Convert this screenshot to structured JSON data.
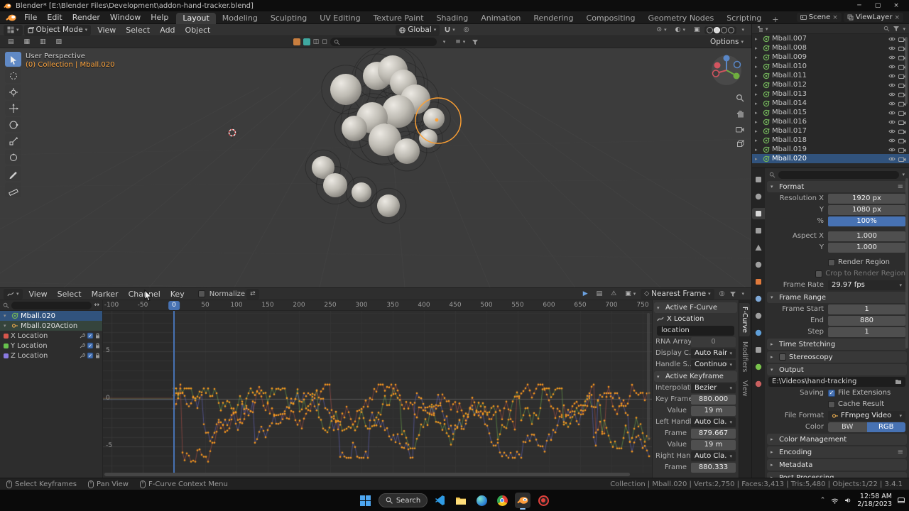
{
  "window": {
    "title": "Blender* [E:\\Blender Files\\Development\\addon-hand-tracker.blend]"
  },
  "topbar": {
    "menus": [
      "File",
      "Edit",
      "Render",
      "Window",
      "Help"
    ],
    "workspaces": [
      "Layout",
      "Modeling",
      "Sculpting",
      "UV Editing",
      "Texture Paint",
      "Shading",
      "Animation",
      "Rendering",
      "Compositing",
      "Geometry Nodes",
      "Scripting"
    ],
    "active_workspace": "Layout",
    "add_workspace": "+",
    "scene": "Scene",
    "view_layer": "ViewLayer"
  },
  "viewport": {
    "mode": "Object Mode",
    "menus": [
      "View",
      "Select",
      "Add",
      "Object"
    ],
    "orientation": "Global",
    "options_label": "Options",
    "overlay": {
      "perspective": "User Perspective",
      "collection": "(0) Collection | Mball.020"
    }
  },
  "outliner": {
    "items": [
      "Mball.007",
      "Mball.008",
      "Mball.009",
      "Mball.010",
      "Mball.011",
      "Mball.012",
      "Mball.013",
      "Mball.014",
      "Mball.015",
      "Mball.016",
      "Mball.017",
      "Mball.018",
      "Mball.019",
      "Mball.020"
    ],
    "active": "Mball.020"
  },
  "properties": {
    "sections": [
      {
        "title": "Format",
        "expanded": true,
        "preset_icon": true,
        "rows": [
          {
            "t": "field",
            "label": "Resolution X",
            "value": "1920 px"
          },
          {
            "t": "field",
            "label": "Y",
            "value": "1080 px"
          },
          {
            "t": "slider",
            "label": "%",
            "value": "100%"
          },
          {
            "t": "gap"
          },
          {
            "t": "field",
            "label": "Aspect X",
            "value": "1.000"
          },
          {
            "t": "field",
            "label": "Y",
            "value": "1.000"
          },
          {
            "t": "gap"
          },
          {
            "t": "check",
            "label": "Render Region",
            "checked": false
          },
          {
            "t": "check",
            "label": "Crop to Render Region",
            "checked": false,
            "dim": true
          },
          {
            "t": "dropdown",
            "label": "Frame Rate",
            "value": "29.97 fps"
          }
        ]
      },
      {
        "title": "Frame Range",
        "expanded": true,
        "rows": [
          {
            "t": "field",
            "label": "Frame Start",
            "value": "1"
          },
          {
            "t": "field",
            "label": "End",
            "value": "880"
          },
          {
            "t": "field",
            "label": "Step",
            "value": "1"
          }
        ]
      },
      {
        "title": "Time Stretching",
        "expanded": false
      },
      {
        "title": "Stereoscopy",
        "expanded": false,
        "checkbox": true
      },
      {
        "title": "Output",
        "expanded": true,
        "rows": [
          {
            "t": "path",
            "value": "E:\\Videos\\hand-tracking"
          },
          {
            "t": "check",
            "prefix": "Saving",
            "label": "File Extensions",
            "checked": true
          },
          {
            "t": "check",
            "label": "Cache Result",
            "checked": false
          },
          {
            "t": "dropdown",
            "label": "File Format",
            "value": "FFmpeg Video",
            "icon": true
          },
          {
            "t": "toggle2",
            "label": "Color",
            "options": [
              "BW",
              "RGB"
            ],
            "active": 1
          }
        ]
      },
      {
        "title": "Color Management",
        "expanded": false
      },
      {
        "title": "Encoding",
        "expanded": false,
        "preset_icon": true
      },
      {
        "title": "Metadata",
        "expanded": false
      },
      {
        "title": "Post Processing",
        "expanded": false
      }
    ]
  },
  "graph_editor": {
    "menus": [
      "View",
      "Select",
      "Marker",
      "Channel",
      "Key"
    ],
    "normalize_label": "Normalize",
    "snap_value": "Nearest Frame",
    "playhead": "0",
    "ruler": [
      "-100",
      "-50",
      "0",
      "50",
      "100",
      "150",
      "200",
      "250",
      "300",
      "350",
      "400",
      "450",
      "500",
      "550",
      "600",
      "650",
      "700",
      "750"
    ],
    "y_labels": [
      "5",
      "0",
      "-5"
    ],
    "channels": [
      {
        "label": "Mball.020",
        "kind": "object"
      },
      {
        "label": "Mball.020Action",
        "kind": "action"
      },
      {
        "label": "X Location",
        "color": "#d8564c"
      },
      {
        "label": "Y Location",
        "color": "#67c14d"
      },
      {
        "label": "Z Location",
        "color": "#8a7ae0"
      }
    ],
    "curve_color": "#fb9b1e",
    "playhead_color": "#4772b3"
  },
  "graph_sidebar": {
    "tabs": [
      {
        "label": "F-Curve",
        "active": true
      },
      {
        "label": "Modifiers",
        "active": false
      },
      {
        "label": "View",
        "active": false
      }
    ],
    "panels": [
      {
        "title": "Active F-Curve",
        "rows": [
          {
            "t": "title_icon",
            "value": "X Location"
          },
          {
            "t": "wide_field",
            "value": "location"
          },
          {
            "t": "field",
            "label": "RNA Array...",
            "value": "0",
            "dim": true
          },
          {
            "t": "dropdown",
            "label": "Display C...",
            "value": "Auto Rainbow"
          },
          {
            "t": "dropdown",
            "label": "Handle S...",
            "value": "Continuous ..."
          }
        ]
      },
      {
        "title": "Active Keyframe",
        "rows": [
          {
            "t": "dropdown",
            "label": "Interpolation",
            "value": "Bezier"
          },
          {
            "t": "field",
            "label": "Key Frame",
            "value": "880.000"
          },
          {
            "t": "field",
            "label": "Value",
            "value": "19 m"
          },
          {
            "t": "dropdown",
            "label": "Left Handl...",
            "value": "Auto Cla..."
          },
          {
            "t": "field",
            "label": "Frame",
            "value": "879.667"
          },
          {
            "t": "field",
            "label": "Value",
            "value": "19 m"
          },
          {
            "t": "dropdown",
            "label": "Right Han...",
            "value": "Auto Cla..."
          },
          {
            "t": "field",
            "label": "Frame",
            "value": "880.333"
          }
        ]
      }
    ]
  },
  "status_bar": {
    "hints": [
      "Select Keyframes",
      "Pan View",
      "F-Curve Context Menu"
    ],
    "info": "Collection | Mball.020 | Verts:2,750 | Faces:3,413 | Tris:5,480 | Objects:1/22 | 3.4.1"
  },
  "taskbar": {
    "search_label": "Search",
    "time": "12:58 AM",
    "date": "2/18/2023"
  }
}
